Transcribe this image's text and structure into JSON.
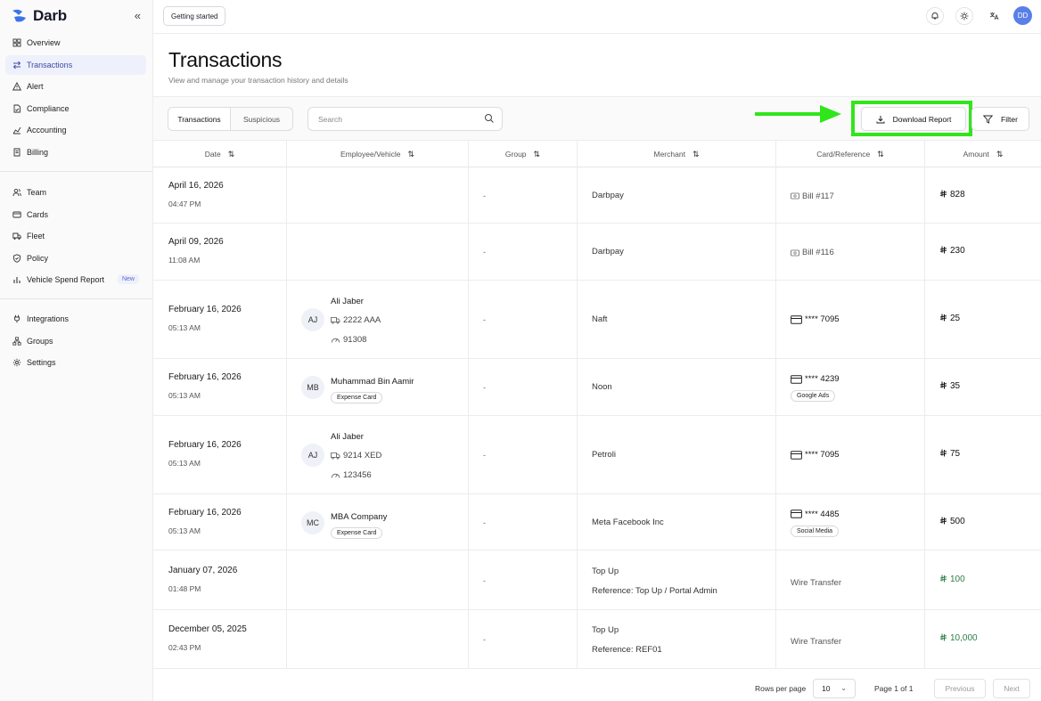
{
  "app": {
    "name": "Darb"
  },
  "sidebar": {
    "groups": [
      [
        {
          "label": "Overview",
          "icon": "grid-icon"
        },
        {
          "label": "Transactions",
          "icon": "arrows-icon",
          "active": true
        },
        {
          "label": "Alert",
          "icon": "alert-icon"
        },
        {
          "label": "Compliance",
          "icon": "file-check-icon"
        },
        {
          "label": "Accounting",
          "icon": "chart-icon"
        },
        {
          "label": "Billing",
          "icon": "receipt-icon"
        }
      ],
      [
        {
          "label": "Team",
          "icon": "users-icon"
        },
        {
          "label": "Cards",
          "icon": "card-icon"
        },
        {
          "label": "Fleet",
          "icon": "truck-icon"
        },
        {
          "label": "Policy",
          "icon": "shield-icon"
        },
        {
          "label": "Vehicle Spend Report",
          "icon": "bar-chart-icon",
          "badge": "New"
        }
      ],
      [
        {
          "label": "Integrations",
          "icon": "plug-icon"
        },
        {
          "label": "Groups",
          "icon": "network-icon"
        },
        {
          "label": "Settings",
          "icon": "gear-icon"
        }
      ]
    ]
  },
  "topbar": {
    "getting_started": "Getting started",
    "user_initials": "DD"
  },
  "header": {
    "title": "Transactions",
    "subtitle": "View and manage your transaction history and details"
  },
  "toolbar": {
    "tabs": [
      "Transactions",
      "Suspicious"
    ],
    "search_placeholder": "Search",
    "download_label": "Download Report",
    "filter_label": "Filter"
  },
  "table": {
    "columns": [
      "Date",
      "Employee/Vehicle",
      "Group",
      "Merchant",
      "Card/Reference",
      "Amount"
    ],
    "rows": [
      {
        "date": "April 16, 2026",
        "time": "04:47 PM",
        "group": "-",
        "merchant": "Darbpay",
        "bill": "Bill #117",
        "amount": "828"
      },
      {
        "date": "April 09, 2026",
        "time": "11:08 AM",
        "group": "-",
        "merchant": "Darbpay",
        "bill": "Bill #116",
        "amount": "230"
      },
      {
        "date": "February 16, 2026",
        "time": "05:13 AM",
        "initials": "AJ",
        "name": "Ali Jaber",
        "plate": "2222 AAA",
        "odometer": "91308",
        "group": "-",
        "merchant": "Naft",
        "card": "**** 7095",
        "amount": "25"
      },
      {
        "date": "February 16, 2026",
        "time": "05:13 AM",
        "initials": "MB",
        "name": "Muhammad Bin Aamir",
        "tag": "Expense Card",
        "group": "-",
        "merchant": "Noon",
        "card": "**** 4239",
        "card_tag": "Google Ads",
        "amount": "35"
      },
      {
        "date": "February 16, 2026",
        "time": "05:13 AM",
        "initials": "AJ",
        "name": "Ali Jaber",
        "plate": "9214 XED",
        "odometer": "123456",
        "group": "-",
        "merchant": "Petroli",
        "card": "**** 7095",
        "amount": "75"
      },
      {
        "date": "February 16, 2026",
        "time": "05:13 AM",
        "initials": "MC",
        "name": "MBA Company",
        "tag": "Expense Card",
        "group": "-",
        "merchant": "Meta Facebook Inc",
        "card": "**** 4485",
        "card_tag": "Social Media",
        "amount": "500"
      },
      {
        "date": "January 07, 2026",
        "time": "01:48 PM",
        "group": "-",
        "merchant": "Top Up",
        "merchant_ref": "Reference: Top Up / Portal Admin",
        "reference": "Wire Transfer",
        "amount": "100",
        "credit": true
      },
      {
        "date": "December 05, 2025",
        "time": "02:43 PM",
        "group": "-",
        "merchant": "Top Up",
        "merchant_ref": "Reference: REF01",
        "reference": "Wire Transfer",
        "amount": "10,000",
        "credit": true
      }
    ]
  },
  "pagination": {
    "rows_label": "Rows per page",
    "rows_value": "10",
    "page_info": "Page 1 of 1",
    "prev": "Previous",
    "next": "Next"
  },
  "colors": {
    "accent": "#3b4ba8",
    "highlight": "#31e51b",
    "credit": "#2e7d4a"
  }
}
